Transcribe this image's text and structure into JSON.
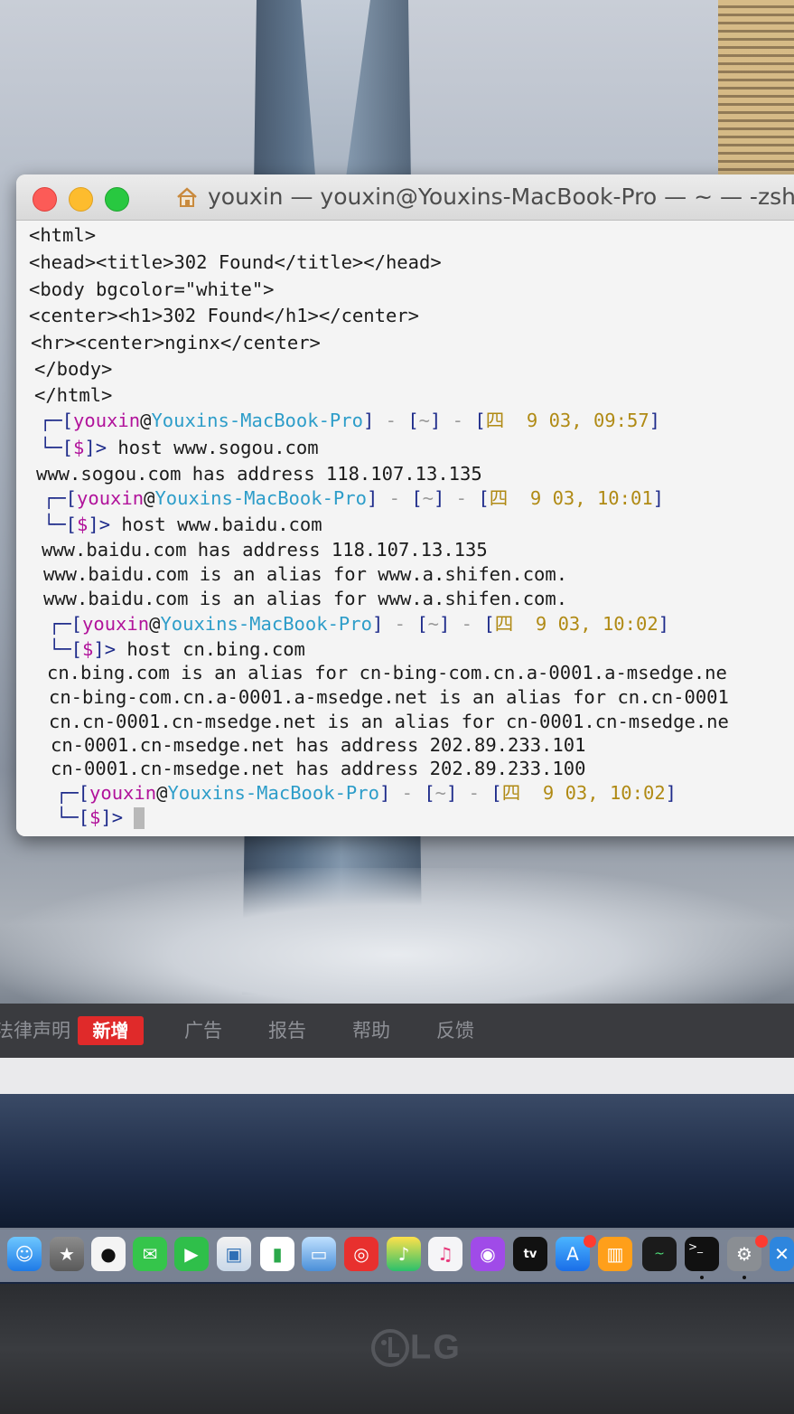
{
  "terminal": {
    "title": "youxin — youxin@Youxins-MacBook-Pro — ~ — -zsh",
    "html_lines": [
      "<html>",
      "<head><title>302 Found</title></head>",
      "<body bgcolor=\"white\">",
      "<center><h1>302 Found</h1></center>",
      "<hr><center>nginx</center>",
      "</body>",
      "</html>"
    ],
    "prompt": {
      "user": "youxin",
      "at": "@",
      "host": "Youxins-MacBook-Pro",
      "dir": "~",
      "dollar": "$"
    },
    "sessions": [
      {
        "date": "四  9 03, 09:57",
        "command": "host www.sogou.com",
        "output": [
          "www.sogou.com has address 118.107.13.135"
        ]
      },
      {
        "date": "四  9 03, 10:01",
        "command": "host www.baidu.com",
        "output": [
          "www.baidu.com has address 118.107.13.135",
          "www.baidu.com is an alias for www.a.shifen.com.",
          "www.baidu.com is an alias for www.a.shifen.com."
        ]
      },
      {
        "date": "四  9 03, 10:02",
        "command": "host cn.bing.com",
        "output": [
          "cn.bing.com is an alias for cn-bing-com.cn.a-0001.a-msedge.ne",
          "cn-bing-com.cn.a-0001.a-msedge.net is an alias for cn.cn-0001",
          "cn.cn-0001.cn-msedge.net is an alias for cn-0001.cn-msedge.ne",
          "cn-0001.cn-msedge.net has address 202.89.233.101",
          "cn-0001.cn-msedge.net has address 202.89.233.100"
        ]
      },
      {
        "date": "四  9 03, 10:02",
        "command": "",
        "output": []
      }
    ]
  },
  "browser_bar": {
    "items": [
      "法律声明",
      "新增",
      "广告",
      "报告",
      "帮助",
      "反馈"
    ]
  },
  "dock": {
    "icons": [
      "finder-icon",
      "blank-icon",
      "qq-icon",
      "wechat-icon",
      "facetime-icon",
      "preview-icon",
      "numbers-icon",
      "keynote-icon",
      "netease-music-icon",
      "qq-music-icon",
      "itunes-icon",
      "podcasts-icon",
      "apple-tv-icon",
      "app-store-icon",
      "books-icon",
      "activity-monitor-icon",
      "terminal-icon",
      "system-preferences-icon",
      "xcode-icon"
    ],
    "tv_label": "tv"
  },
  "monitor": {
    "brand": "LG"
  }
}
